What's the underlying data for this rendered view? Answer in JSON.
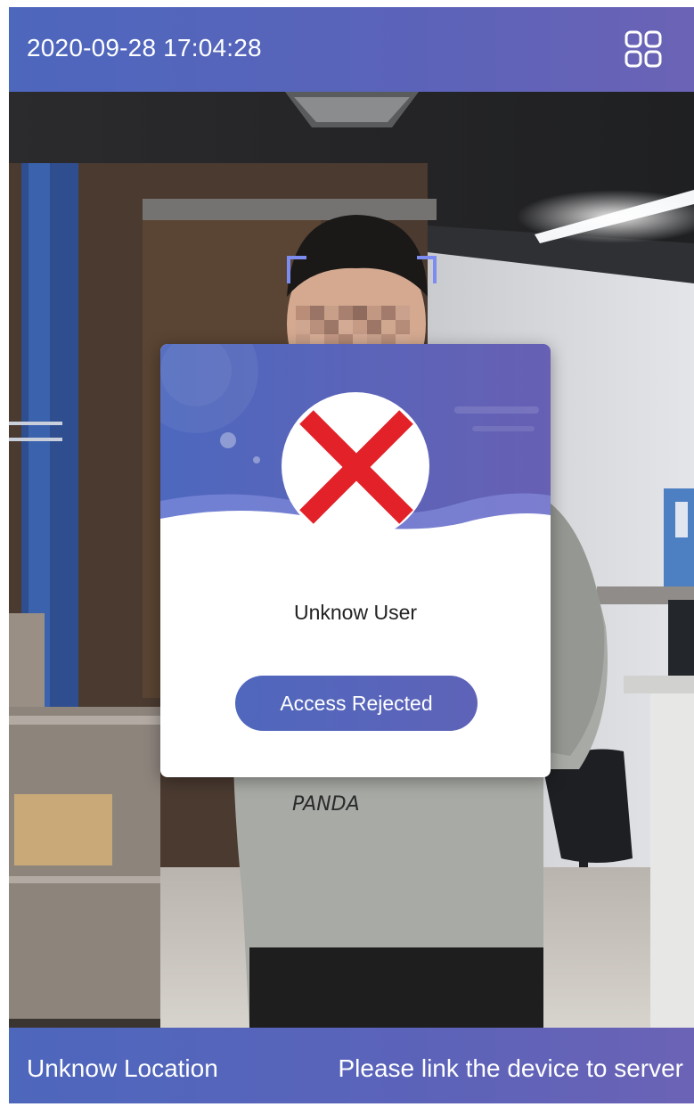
{
  "topbar": {
    "datetime": "2020-09-28 17:04:28",
    "menu_icon": "grid-menu-icon"
  },
  "dialog": {
    "status_icon": "red-cross-icon",
    "user_name": "Unknow User",
    "result_label": "Access Rejected"
  },
  "bottombar": {
    "location": "Unknow Location",
    "server_status": "Please link the device to server"
  },
  "colors": {
    "bar_start": "#4d67bd",
    "bar_end": "#6b63b6",
    "reject_red": "#e32128",
    "face_frame": "#7c8cf0"
  }
}
